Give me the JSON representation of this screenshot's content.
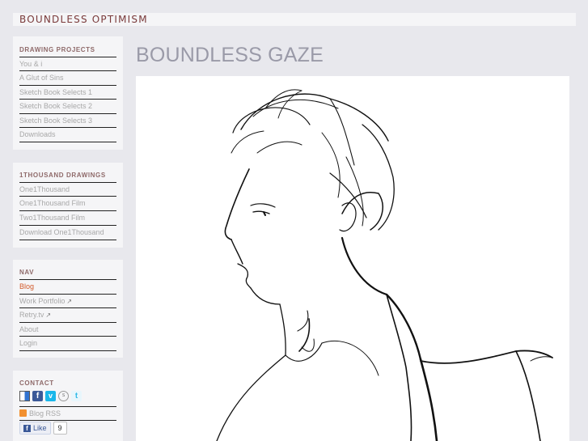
{
  "site": {
    "title": "BOUNDLESS OPTIMISM"
  },
  "sections": {
    "drawing_projects": {
      "heading": "DRAWING PROJECTS",
      "items": [
        {
          "label": "You & i"
        },
        {
          "label": "A Glut of Sins"
        },
        {
          "label": "Sketch Book Selects 1"
        },
        {
          "label": "Sketch Book Selects 2"
        },
        {
          "label": "Sketch Book Selects 3"
        },
        {
          "label": "Downloads"
        }
      ]
    },
    "thousand": {
      "heading": "1THOUSAND DRAWINGS",
      "items": [
        {
          "label": "One1Thousand"
        },
        {
          "label": "One1Thousand Film"
        },
        {
          "label": "Two1Thousand Film"
        },
        {
          "label": "Download One1Thousand"
        }
      ]
    },
    "nav": {
      "heading": "NAV",
      "items": [
        {
          "label": "Blog",
          "active": true
        },
        {
          "label": "Work Portfolio",
          "external": true
        },
        {
          "label": "Retry.tv",
          "external": true
        },
        {
          "label": "About"
        },
        {
          "label": "Login"
        }
      ]
    },
    "contact": {
      "heading": "CONTACT",
      "social_icons": [
        "delicious-icon",
        "facebook-icon",
        "vimeo-icon",
        "skype-icon",
        "twitter-icon"
      ],
      "rss_label": "Blog RSS",
      "like_label": "Like",
      "like_count": "9"
    }
  },
  "main": {
    "title": "BOUNDLESS GAZE",
    "artwork_icon": "ink-sketch-portrait"
  },
  "colors": {
    "background": "#e8e8ed",
    "panel": "#f5f5f7",
    "title": "#7a3a3a",
    "heading": "#8f6a6a",
    "link": "#a8a8a8",
    "active": "#d25a2a",
    "page_title": "#9a9aa8"
  }
}
